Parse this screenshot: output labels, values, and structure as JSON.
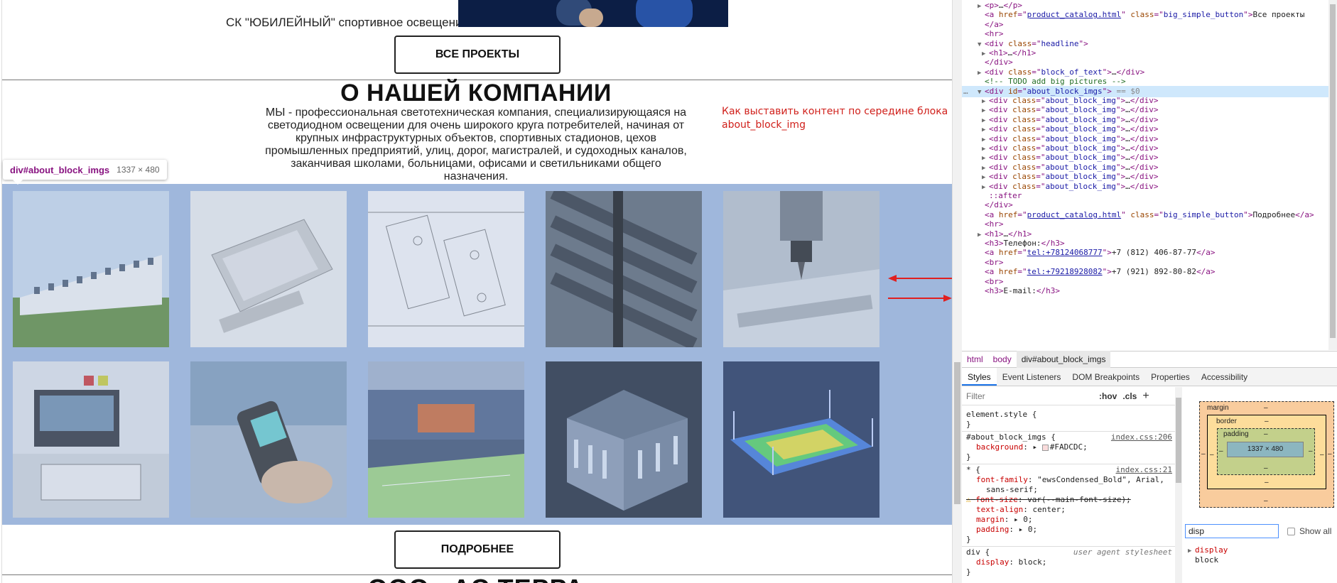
{
  "page": {
    "project_caption": "СК \"ЮБИЛЕЙНЫЙ\" спортивное освещение",
    "all_projects_button": "ВСЕ ПРОЕКТЫ",
    "headline": "О НАШЕЙ КОМПАНИИ",
    "about_text": "МЫ - профессиональная светотехническая компания, специализирующаяся на светодиодном освещении для очень широкого круга потребителей, начиная от крупных инфраструктурных объектов, спортивных стадионов, цехов промышленных предприятий, улиц, дорог, магистралей, и судоходных каналов, заканчивая школами, больницами, офисами и светильниками общего назначения.",
    "todo_note": "Как выставить контент по середине блока about_block_img",
    "more_button": "ПОДРОБНЕЕ",
    "bottom_heading": "ООО «АС ТЕРРА",
    "tooltip": {
      "selector": "div#about_block_imgs",
      "size": "1337 × 480"
    },
    "images": [
      "building",
      "panel",
      "blueprint",
      "led-strips",
      "cnc-machine",
      "lab-equipment",
      "lux-meter",
      "stadium",
      "lit-building",
      "light-map"
    ]
  },
  "devtools": {
    "dom_lines": [
      {
        "indent": 2,
        "html": "<span class='tri'>▶</span><span class='tag'>&lt;p&gt;</span>…<span class='tag'>&lt;/p&gt;</span>"
      },
      {
        "indent": 2,
        "html": "<span class='tri'></span><span class='tag'>&lt;a </span><span class='an'>href</span><span class='tag'>=\"</span><span class='link'>product_catalog.html</span><span class='tag'>\" </span><span class='an'>class</span><span class='tag'>=\"</span><span class='av'>big_simple_button</span><span class='tag'>\"&gt;</span>Все проекты"
      },
      {
        "indent": 2,
        "html": "<span class='tri'></span><span class='tag'>&lt;/a&gt;</span>"
      },
      {
        "indent": 2,
        "html": "<span class='tri'></span><span class='tag'>&lt;hr&gt;</span>"
      },
      {
        "indent": 2,
        "html": "<span class='tri'>▼</span><span class='tag'>&lt;div </span><span class='an'>class</span><span class='tag'>=\"</span><span class='av'>headline</span><span class='tag'>\"&gt;</span>"
      },
      {
        "indent": 3,
        "html": "<span class='tri'>▶</span><span class='tag'>&lt;h1&gt;</span>…<span class='tag'>&lt;/h1&gt;</span>"
      },
      {
        "indent": 2,
        "html": "<span class='tri'></span><span class='tag'>&lt;/div&gt;</span>"
      },
      {
        "indent": 2,
        "html": "<span class='tri'>▶</span><span class='tag'>&lt;div </span><span class='an'>class</span><span class='tag'>=\"</span><span class='av'>block_of_text</span><span class='tag'>\"&gt;</span>…<span class='tag'>&lt;/div&gt;</span>"
      },
      {
        "indent": 2,
        "html": "<span class='tri'></span><span class='cm'>&lt;!-- TODO add big pictures --&gt;</span>"
      },
      {
        "indent": 2,
        "selected": true,
        "html": "<span class='tri'>▼</span><span class='tag'>&lt;div </span><span class='an'>id</span><span class='tag'>=\"</span><span class='av'>about_block_imgs</span><span class='tag'>\"&gt;</span> <span class='eq'>== $0</span>"
      },
      {
        "indent": 3,
        "html": "<span class='tri'>▶</span><span class='tag'>&lt;div </span><span class='an'>class</span><span class='tag'>=\"</span><span class='av'>about_block_img</span><span class='tag'>\"&gt;</span>…<span class='tag'>&lt;/div&gt;</span>"
      },
      {
        "indent": 3,
        "html": "<span class='tri'>▶</span><span class='tag'>&lt;div </span><span class='an'>class</span><span class='tag'>=\"</span><span class='av'>about_block_img</span><span class='tag'>\"&gt;</span>…<span class='tag'>&lt;/div&gt;</span>"
      },
      {
        "indent": 3,
        "html": "<span class='tri'>▶</span><span class='tag'>&lt;div </span><span class='an'>class</span><span class='tag'>=\"</span><span class='av'>about_block_img</span><span class='tag'>\"&gt;</span>…<span class='tag'>&lt;/div&gt;</span>"
      },
      {
        "indent": 3,
        "html": "<span class='tri'>▶</span><span class='tag'>&lt;div </span><span class='an'>class</span><span class='tag'>=\"</span><span class='av'>about_block_img</span><span class='tag'>\"&gt;</span>…<span class='tag'>&lt;/div&gt;</span>"
      },
      {
        "indent": 3,
        "html": "<span class='tri'>▶</span><span class='tag'>&lt;div </span><span class='an'>class</span><span class='tag'>=\"</span><span class='av'>about_block_img</span><span class='tag'>\"&gt;</span>…<span class='tag'>&lt;/div&gt;</span>"
      },
      {
        "indent": 3,
        "html": "<span class='tri'>▶</span><span class='tag'>&lt;div </span><span class='an'>class</span><span class='tag'>=\"</span><span class='av'>about_block_img</span><span class='tag'>\"&gt;</span>…<span class='tag'>&lt;/div&gt;</span>"
      },
      {
        "indent": 3,
        "html": "<span class='tri'>▶</span><span class='tag'>&lt;div </span><span class='an'>class</span><span class='tag'>=\"</span><span class='av'>about_block_img</span><span class='tag'>\"&gt;</span>…<span class='tag'>&lt;/div&gt;</span>"
      },
      {
        "indent": 3,
        "html": "<span class='tri'>▶</span><span class='tag'>&lt;div </span><span class='an'>class</span><span class='tag'>=\"</span><span class='av'>about_block_img</span><span class='tag'>\"&gt;</span>…<span class='tag'>&lt;/div&gt;</span>"
      },
      {
        "indent": 3,
        "html": "<span class='tri'>▶</span><span class='tag'>&lt;div </span><span class='an'>class</span><span class='tag'>=\"</span><span class='av'>about_block_img</span><span class='tag'>\"&gt;</span>…<span class='tag'>&lt;/div&gt;</span>"
      },
      {
        "indent": 3,
        "html": "<span class='tri'>▶</span><span class='tag'>&lt;div </span><span class='an'>class</span><span class='tag'>=\"</span><span class='av'>about_block_img</span><span class='tag'>\"&gt;</span>…<span class='tag'>&lt;/div&gt;</span>"
      },
      {
        "indent": 3,
        "html": "<span class='tri'></span><span class='pseudo'>::after</span>"
      },
      {
        "indent": 2,
        "html": "<span class='tri'></span><span class='tag'>&lt;/div&gt;</span>"
      },
      {
        "indent": 2,
        "html": "<span class='tri'></span><span class='tag'>&lt;a </span><span class='an'>href</span><span class='tag'>=\"</span><span class='link'>product_catalog.html</span><span class='tag'>\" </span><span class='an'>class</span><span class='tag'>=\"</span><span class='av'>big_simple_button</span><span class='tag'>\"&gt;</span>Подробнее<span class='tag'>&lt;/a&gt;</span>"
      },
      {
        "indent": 2,
        "html": "<span class='tri'></span><span class='tag'>&lt;hr&gt;</span>"
      },
      {
        "indent": 2,
        "html": "<span class='tri'>▶</span><span class='tag'>&lt;h1&gt;</span>…<span class='tag'>&lt;/h1&gt;</span>"
      },
      {
        "indent": 2,
        "html": "<span class='tri'></span><span class='tag'>&lt;h3&gt;</span>Телефон:<span class='tag'>&lt;/h3&gt;</span>"
      },
      {
        "indent": 2,
        "html": "<span class='tri'></span><span class='tag'>&lt;a </span><span class='an'>href</span><span class='tag'>=\"</span><span class='link'>tel:+78124068777</span><span class='tag'>\"&gt;</span>+7 (812) 406-87-77<span class='tag'>&lt;/a&gt;</span>"
      },
      {
        "indent": 2,
        "html": "<span class='tri'></span><span class='tag'>&lt;br&gt;</span>"
      },
      {
        "indent": 2,
        "html": "<span class='tri'></span><span class='tag'>&lt;a </span><span class='an'>href</span><span class='tag'>=\"</span><span class='link'>tel:+79218928082</span><span class='tag'>\"&gt;</span>+7 (921) 892-80-82<span class='tag'>&lt;/a&gt;</span>"
      },
      {
        "indent": 2,
        "html": "<span class='tri'></span><span class='tag'>&lt;br&gt;</span>"
      },
      {
        "indent": 2,
        "html": "<span class='tri'></span><span class='tag'>&lt;h3&gt;</span>E-mail:<span class='tag'>&lt;/h3&gt;</span>"
      }
    ],
    "breadcrumbs": [
      "html",
      "body",
      "div#about_block_imgs"
    ],
    "tabs": [
      "Styles",
      "Event Listeners",
      "DOM Breakpoints",
      "Properties",
      "Accessibility"
    ],
    "filter_placeholder": "Filter",
    "hov_label": ":hov",
    "cls_label": ".cls",
    "plus_label": "+",
    "rules": {
      "element_style": "element.style {",
      "close": "}",
      "rule1_selector": "#about_block_imgs {",
      "rule1_source": "index.css:206",
      "rule1_prop": "background",
      "rule1_value": "#FADCDC;",
      "rule2_selector": "* {",
      "rule2_source": "index.css:21",
      "ff_prop": "font-family",
      "ff_value": "\"ewsCondensed_Bold\", Arial,",
      "ff_value2": "sans-serif;",
      "fs_prop": "font-size",
      "fs_value": "var(--main-font-size);",
      "ta_prop": "text-align",
      "ta_value": "center;",
      "m_prop": "margin",
      "m_value": "0;",
      "p_prop": "padding",
      "p_value": "0;",
      "ua_selector": "div {",
      "ua_label": "user agent stylesheet",
      "d_prop": "display",
      "d_value": "block;"
    },
    "box_model": {
      "margin": "margin",
      "border": "border",
      "padding": "padding",
      "content": "1337 × 480",
      "dash": "–"
    },
    "computed_filter": "disp",
    "show_all": "Show all",
    "computed_prop": "display",
    "computed_value": "block",
    "colors": {
      "highlight": "#9fb7dc",
      "swatch": "#FADCDC",
      "tag": "#881280",
      "attr": "#994500",
      "value": "#1a1aa6",
      "selected_row": "#cfe8fc"
    }
  }
}
